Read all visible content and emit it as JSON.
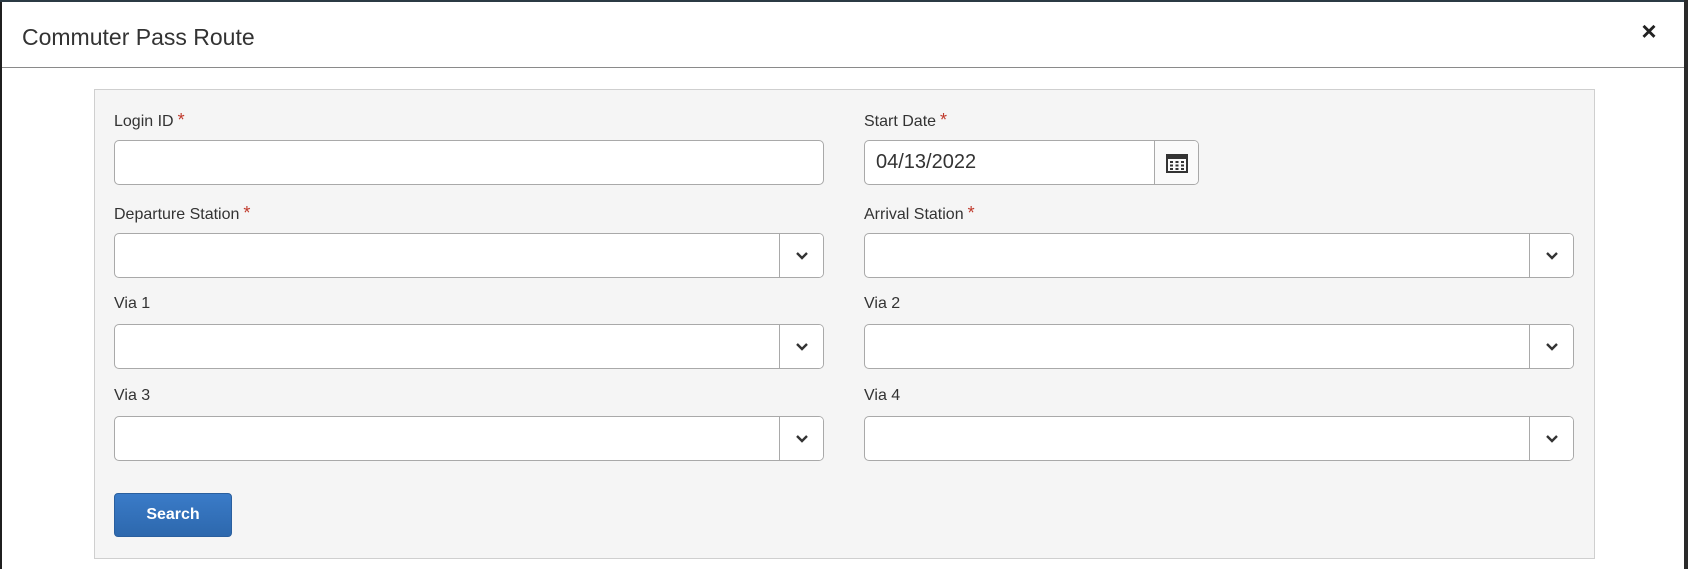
{
  "modal": {
    "title": "Commuter Pass Route",
    "close_label": "×"
  },
  "form": {
    "login_id": {
      "label": "Login ID",
      "required_mark": "*",
      "value": ""
    },
    "start_date": {
      "label": "Start Date",
      "required_mark": "*",
      "value": "04/13/2022"
    },
    "departure_station": {
      "label": "Departure Station",
      "required_mark": "*",
      "value": ""
    },
    "arrival_station": {
      "label": "Arrival Station",
      "required_mark": "*",
      "value": ""
    },
    "via1": {
      "label": "Via 1",
      "value": ""
    },
    "via2": {
      "label": "Via 2",
      "value": ""
    },
    "via3": {
      "label": "Via 3",
      "value": ""
    },
    "via4": {
      "label": "Via 4",
      "value": ""
    },
    "search_label": "Search"
  },
  "icons": {
    "calendar": "calendar-icon",
    "chevron": "chevron-down-icon",
    "close": "close-icon"
  },
  "colors": {
    "primary_button": "#3a7bc8",
    "required": "#c0392b",
    "panel_bg": "#f5f5f5"
  }
}
